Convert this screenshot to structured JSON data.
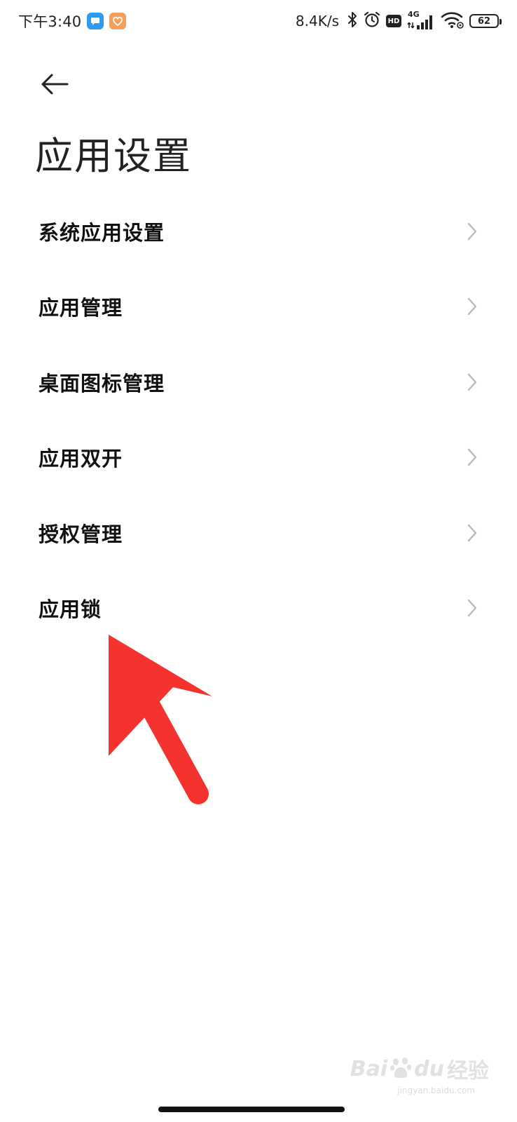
{
  "status_bar": {
    "time": "下午3:40",
    "net_speed": "8.4K/s",
    "hd_label": "HD",
    "network_label": "4G",
    "battery_level": "62"
  },
  "header": {
    "title": "应用设置"
  },
  "menu": {
    "items": [
      {
        "label": "系统应用设置"
      },
      {
        "label": "应用管理"
      },
      {
        "label": "桌面图标管理"
      },
      {
        "label": "应用双开"
      },
      {
        "label": "授权管理"
      },
      {
        "label": "应用锁"
      }
    ]
  },
  "watermark": {
    "brand": "Bai",
    "brand_suffix": "du",
    "brand_cn": "经验",
    "url": "jingyan.baidu.com"
  },
  "colors": {
    "arrow": "#f4332f",
    "chevron": "#b8b8b8",
    "chat_badge": "#2f9bf0",
    "health_badge": "#f5a05a"
  }
}
